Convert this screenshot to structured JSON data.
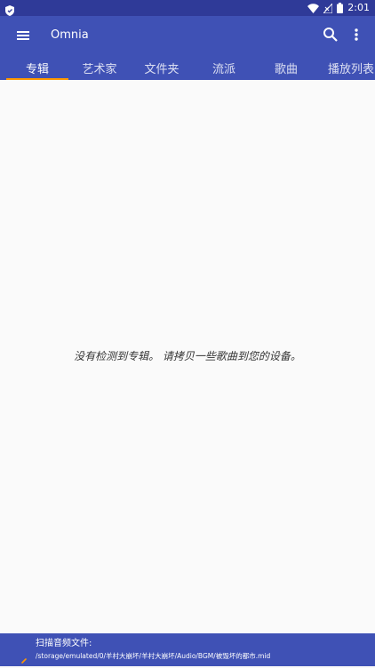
{
  "status_bar": {
    "time": "2:01",
    "left_icon": "shield-icon",
    "icons": [
      "wifi-icon",
      "no-signal-icon",
      "battery-icon"
    ]
  },
  "app_bar": {
    "title": "Omnia",
    "menu_icon": "menu-icon",
    "search_icon": "search-icon",
    "overflow_icon": "more-vert-icon"
  },
  "tabs": [
    {
      "label": "专辑",
      "active": true
    },
    {
      "label": "艺术家",
      "active": false
    },
    {
      "label": "文件夹",
      "active": false
    },
    {
      "label": "流派",
      "active": false
    },
    {
      "label": "歌曲",
      "active": false
    },
    {
      "label": "播放列表",
      "active": false
    }
  ],
  "content": {
    "empty_message": "没有检测到专辑。 请拷贝一些歌曲到您的设备。"
  },
  "scan": {
    "title": "扫描音频文件:",
    "path": "/storage/emulated/0/羊村大崩坏/羊村大崩坏/Audio/BGM/被毁坏的都市.mid"
  },
  "colors": {
    "primary": "#3f51b5",
    "status_bar": "#2f3a98",
    "tab_indicator": "#ff9800",
    "background": "#fafafa"
  }
}
